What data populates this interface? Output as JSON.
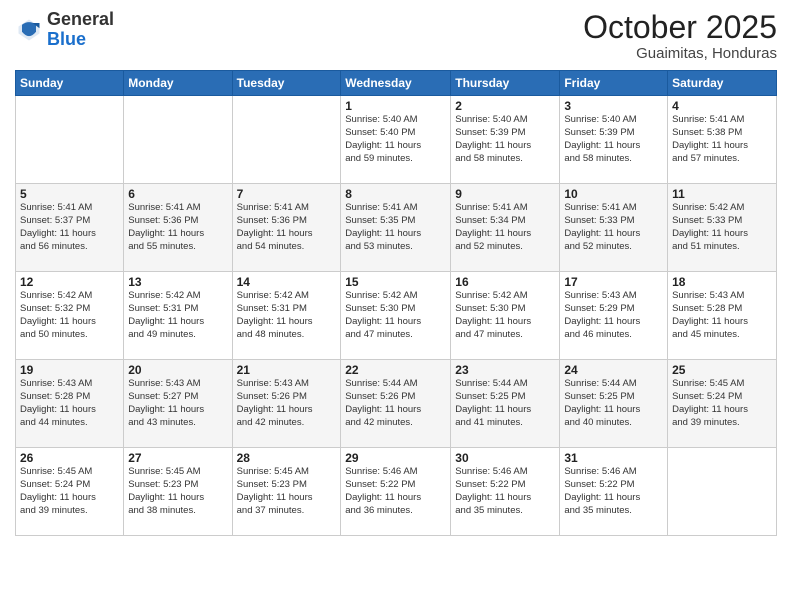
{
  "header": {
    "logo_general": "General",
    "logo_blue": "Blue",
    "month": "October 2025",
    "location": "Guaimitas, Honduras"
  },
  "days_of_week": [
    "Sunday",
    "Monday",
    "Tuesday",
    "Wednesday",
    "Thursday",
    "Friday",
    "Saturday"
  ],
  "weeks": [
    [
      {
        "day": "",
        "info": ""
      },
      {
        "day": "",
        "info": ""
      },
      {
        "day": "",
        "info": ""
      },
      {
        "day": "1",
        "info": "Sunrise: 5:40 AM\nSunset: 5:40 PM\nDaylight: 11 hours\nand 59 minutes."
      },
      {
        "day": "2",
        "info": "Sunrise: 5:40 AM\nSunset: 5:39 PM\nDaylight: 11 hours\nand 58 minutes."
      },
      {
        "day": "3",
        "info": "Sunrise: 5:40 AM\nSunset: 5:39 PM\nDaylight: 11 hours\nand 58 minutes."
      },
      {
        "day": "4",
        "info": "Sunrise: 5:41 AM\nSunset: 5:38 PM\nDaylight: 11 hours\nand 57 minutes."
      }
    ],
    [
      {
        "day": "5",
        "info": "Sunrise: 5:41 AM\nSunset: 5:37 PM\nDaylight: 11 hours\nand 56 minutes."
      },
      {
        "day": "6",
        "info": "Sunrise: 5:41 AM\nSunset: 5:36 PM\nDaylight: 11 hours\nand 55 minutes."
      },
      {
        "day": "7",
        "info": "Sunrise: 5:41 AM\nSunset: 5:36 PM\nDaylight: 11 hours\nand 54 minutes."
      },
      {
        "day": "8",
        "info": "Sunrise: 5:41 AM\nSunset: 5:35 PM\nDaylight: 11 hours\nand 53 minutes."
      },
      {
        "day": "9",
        "info": "Sunrise: 5:41 AM\nSunset: 5:34 PM\nDaylight: 11 hours\nand 52 minutes."
      },
      {
        "day": "10",
        "info": "Sunrise: 5:41 AM\nSunset: 5:33 PM\nDaylight: 11 hours\nand 52 minutes."
      },
      {
        "day": "11",
        "info": "Sunrise: 5:42 AM\nSunset: 5:33 PM\nDaylight: 11 hours\nand 51 minutes."
      }
    ],
    [
      {
        "day": "12",
        "info": "Sunrise: 5:42 AM\nSunset: 5:32 PM\nDaylight: 11 hours\nand 50 minutes."
      },
      {
        "day": "13",
        "info": "Sunrise: 5:42 AM\nSunset: 5:31 PM\nDaylight: 11 hours\nand 49 minutes."
      },
      {
        "day": "14",
        "info": "Sunrise: 5:42 AM\nSunset: 5:31 PM\nDaylight: 11 hours\nand 48 minutes."
      },
      {
        "day": "15",
        "info": "Sunrise: 5:42 AM\nSunset: 5:30 PM\nDaylight: 11 hours\nand 47 minutes."
      },
      {
        "day": "16",
        "info": "Sunrise: 5:42 AM\nSunset: 5:30 PM\nDaylight: 11 hours\nand 47 minutes."
      },
      {
        "day": "17",
        "info": "Sunrise: 5:43 AM\nSunset: 5:29 PM\nDaylight: 11 hours\nand 46 minutes."
      },
      {
        "day": "18",
        "info": "Sunrise: 5:43 AM\nSunset: 5:28 PM\nDaylight: 11 hours\nand 45 minutes."
      }
    ],
    [
      {
        "day": "19",
        "info": "Sunrise: 5:43 AM\nSunset: 5:28 PM\nDaylight: 11 hours\nand 44 minutes."
      },
      {
        "day": "20",
        "info": "Sunrise: 5:43 AM\nSunset: 5:27 PM\nDaylight: 11 hours\nand 43 minutes."
      },
      {
        "day": "21",
        "info": "Sunrise: 5:43 AM\nSunset: 5:26 PM\nDaylight: 11 hours\nand 42 minutes."
      },
      {
        "day": "22",
        "info": "Sunrise: 5:44 AM\nSunset: 5:26 PM\nDaylight: 11 hours\nand 42 minutes."
      },
      {
        "day": "23",
        "info": "Sunrise: 5:44 AM\nSunset: 5:25 PM\nDaylight: 11 hours\nand 41 minutes."
      },
      {
        "day": "24",
        "info": "Sunrise: 5:44 AM\nSunset: 5:25 PM\nDaylight: 11 hours\nand 40 minutes."
      },
      {
        "day": "25",
        "info": "Sunrise: 5:45 AM\nSunset: 5:24 PM\nDaylight: 11 hours\nand 39 minutes."
      }
    ],
    [
      {
        "day": "26",
        "info": "Sunrise: 5:45 AM\nSunset: 5:24 PM\nDaylight: 11 hours\nand 39 minutes."
      },
      {
        "day": "27",
        "info": "Sunrise: 5:45 AM\nSunset: 5:23 PM\nDaylight: 11 hours\nand 38 minutes."
      },
      {
        "day": "28",
        "info": "Sunrise: 5:45 AM\nSunset: 5:23 PM\nDaylight: 11 hours\nand 37 minutes."
      },
      {
        "day": "29",
        "info": "Sunrise: 5:46 AM\nSunset: 5:22 PM\nDaylight: 11 hours\nand 36 minutes."
      },
      {
        "day": "30",
        "info": "Sunrise: 5:46 AM\nSunset: 5:22 PM\nDaylight: 11 hours\nand 35 minutes."
      },
      {
        "day": "31",
        "info": "Sunrise: 5:46 AM\nSunset: 5:22 PM\nDaylight: 11 hours\nand 35 minutes."
      },
      {
        "day": "",
        "info": ""
      }
    ]
  ]
}
